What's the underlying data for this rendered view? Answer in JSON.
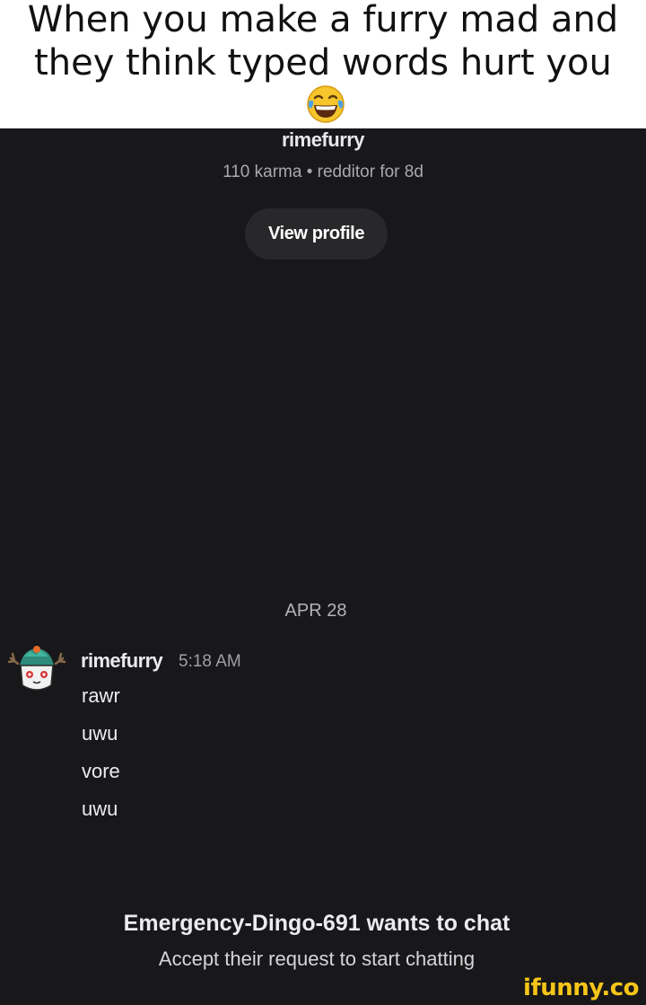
{
  "caption": {
    "text": "When you make a furry mad and they think typed words hurt you",
    "emoji": "tears-of-joy-emoji"
  },
  "profile": {
    "username": "rimefurry",
    "meta": "110 karma • redditor for 8d",
    "view_profile_label": "View profile"
  },
  "conversation": {
    "date_separator": "APR 28",
    "messages": [
      {
        "author": "rimefurry",
        "time": "5:18 AM",
        "lines": [
          "rawr",
          "uwu",
          "vore",
          "uwu"
        ]
      }
    ]
  },
  "chat_request": {
    "title": "Emergency-Dingo-691 wants to chat",
    "subtitle": "Accept their request to start chatting"
  },
  "watermark": {
    "text": "ifunny.co"
  },
  "colors": {
    "background": "#18181a",
    "button": "#28282b",
    "watermark": "#f5c518"
  }
}
